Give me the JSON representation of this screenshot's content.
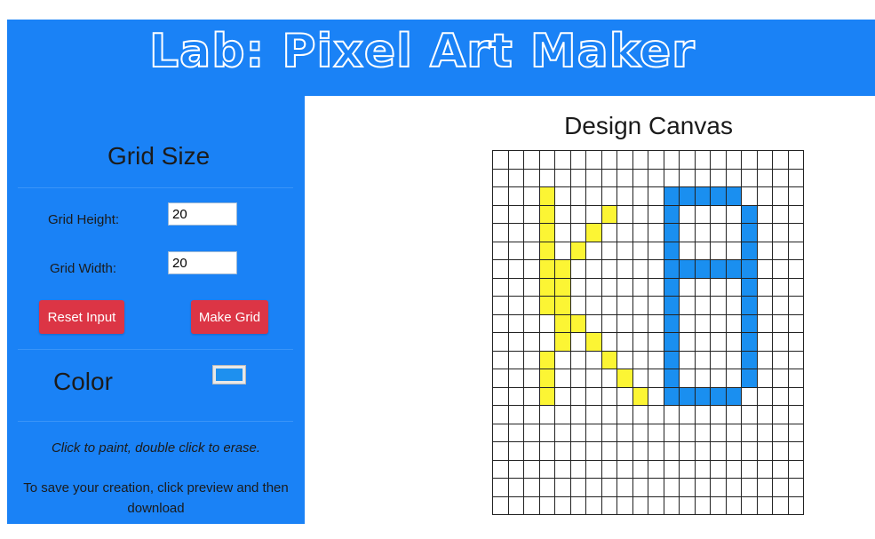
{
  "header": {
    "title": "Lab: Pixel Art Maker"
  },
  "sidebar": {
    "grid_size_title": "Grid Size",
    "height_label": "Grid Height:",
    "height_value": "20",
    "width_label": "Grid Width:",
    "width_value": "20",
    "reset_button": "Reset Input",
    "make_button": "Make Grid",
    "color_title": "Color",
    "selected_color": "#1e90ef",
    "hint": "Click to paint, double click to erase.",
    "save_hint": "To save your creation, click preview and then download"
  },
  "canvas": {
    "title": "Design Canvas",
    "rows": 20,
    "cols": 20,
    "colors": {
      "yellow": "#fcf534",
      "blue": "#1a8ff0"
    },
    "painted": {
      "yellow": [
        [
          2,
          3
        ],
        [
          8,
          3
        ],
        [
          3,
          3
        ],
        [
          7,
          3
        ],
        [
          4,
          3
        ],
        [
          6,
          3
        ],
        [
          5,
          3
        ],
        [
          7,
          4
        ],
        [
          8,
          4
        ],
        [
          9,
          4
        ],
        [
          10,
          4
        ],
        [
          11,
          3
        ],
        [
          12,
          3
        ],
        [
          13,
          3
        ],
        [
          3,
          7
        ],
        [
          4,
          6
        ],
        [
          5,
          5
        ],
        [
          6,
          4
        ],
        [
          9,
          5
        ],
        [
          10,
          6
        ],
        [
          11,
          7
        ],
        [
          12,
          8
        ],
        [
          13,
          9
        ]
      ],
      "blue": [
        [
          2,
          11
        ],
        [
          2,
          12
        ],
        [
          2,
          13
        ],
        [
          2,
          14
        ],
        [
          2,
          15
        ],
        [
          3,
          11
        ],
        [
          4,
          11
        ],
        [
          5,
          11
        ],
        [
          6,
          11
        ],
        [
          7,
          11
        ],
        [
          8,
          11
        ],
        [
          9,
          11
        ],
        [
          10,
          11
        ],
        [
          11,
          11
        ],
        [
          12,
          11
        ],
        [
          13,
          11
        ],
        [
          6,
          12
        ],
        [
          6,
          13
        ],
        [
          6,
          14
        ],
        [
          6,
          15
        ],
        [
          13,
          12
        ],
        [
          13,
          13
        ],
        [
          13,
          14
        ],
        [
          13,
          15
        ],
        [
          3,
          16
        ],
        [
          4,
          16
        ],
        [
          5,
          16
        ],
        [
          6,
          16
        ],
        [
          7,
          16
        ],
        [
          8,
          16
        ],
        [
          9,
          16
        ],
        [
          10,
          16
        ],
        [
          11,
          16
        ],
        [
          12,
          16
        ]
      ]
    }
  }
}
